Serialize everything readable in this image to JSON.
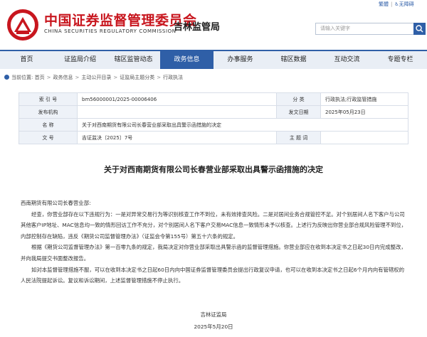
{
  "header": {
    "org_cn": "中国证券监督管理委员会",
    "org_en": "CHINA SECURITIES REGULATORY COMMISSION",
    "bureau": "吉林监管局",
    "top_link_1": "繁體",
    "top_link_2": "无障碍",
    "search_placeholder": "请输入关键字",
    "brand_color": "#c8161e",
    "accent_color": "#2f5fa7"
  },
  "nav": {
    "items": [
      "首页",
      "证监局介绍",
      "辖区监管动态",
      "政务信息",
      "办事服务",
      "辖区数据",
      "互动交流",
      "专题专栏"
    ],
    "active": "政务信息"
  },
  "breadcrumb": {
    "prefix": "当前位置:",
    "items": [
      "首页",
      "政务信息",
      "主动公开目录",
      "证监局主题分类",
      "行政执法"
    ]
  },
  "meta": {
    "index_label": "索 引 号",
    "index_value": "bm56000001/2025-00006406",
    "category_label": "分 类",
    "category_value": "行政执法;行政监管措施",
    "issuer_label": "发布机构",
    "issuer_value": "",
    "date_label": "发文日期",
    "date_value": "2025年05月23日",
    "name_label": "名 称",
    "name_value": "关于对西南期货有限公司长春营业部采取出具警示函措施的决定",
    "docno_label": "文 号",
    "docno_value": "吉证监决〔2025〕7号",
    "subject_label": "主 题 词",
    "subject_value": ""
  },
  "document": {
    "title": "关于对西南期货有限公司长春营业部采取出具警示函措施的决定",
    "addressee": "西南期货有限公司长春营业部:",
    "para1": "经查，你营业部存在以下违规行为：一是对异常交易行为等识别核查工作不到位，未有效排查风险。二是对居间业务合规管控不足。对个别居间人名下客户与公司其他客户IP地址、MAC信息均一致的情形回访工作不充分，对个别居间人名下客户交易MAC信息一致情形未予以核查。上述行为反映出你营业部合规风险管理不到位，内部控制存在缺陷，违反《期货公司监督管理办法》（证监会令第155号）第五十六条的规定。",
    "para2": "根据《期货公司监督管理办法》第一百零九条的规定，我局决定对你营业部采取出具警示函的监督管理措施。你营业部应在收到本决定书之日起30日内完成整改，并向我局提交书面整改报告。",
    "para3": "如对本监督管理措施不服，可以在收到本决定书之日起60日内向中国证券监督管理委员会提出行政复议申请，也可以在收到本决定书之日起6个月内向有管辖权的人民法院提起诉讼。复议和诉讼期间，上述监督管理措施不停止执行。",
    "signer": "吉林证监局",
    "sign_date": "2025年5月20日"
  }
}
